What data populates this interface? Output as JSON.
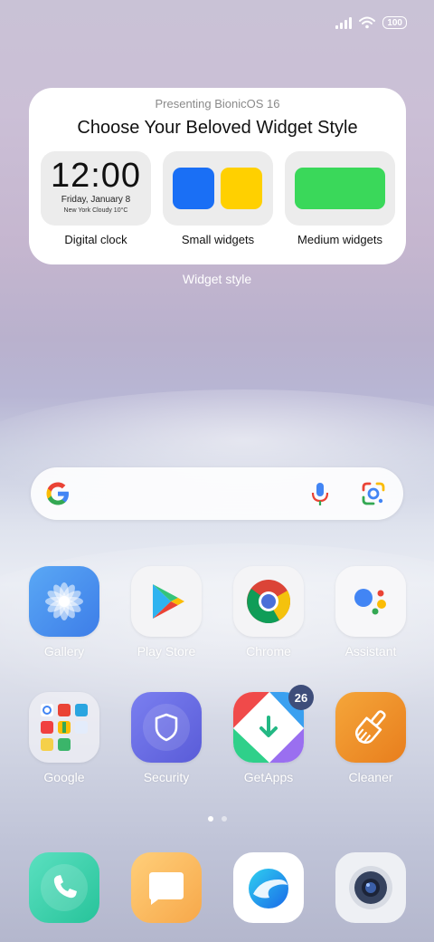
{
  "status_bar": {
    "battery": "100"
  },
  "widget_card": {
    "subtitle": "Presenting BionicOS 16",
    "title": "Choose Your Beloved Widget Style",
    "options": [
      {
        "label": "Digital clock",
        "time": "12:00",
        "date": "Friday, January 8",
        "location": "New York  Cloudy  10°C"
      },
      {
        "label": "Small widgets"
      },
      {
        "label": "Medium widgets"
      }
    ],
    "caption": "Widget style"
  },
  "colors": {
    "small_blue": "#1a6ff5",
    "small_yellow": "#ffd000",
    "medium_green": "#3ad85a"
  },
  "search": {
    "icons": [
      "google-g-icon",
      "microphone-icon",
      "google-lens-icon"
    ]
  },
  "apps": [
    {
      "label": "Gallery"
    },
    {
      "label": "Play Store"
    },
    {
      "label": "Chrome"
    },
    {
      "label": "Assistant"
    },
    {
      "label": "Google"
    },
    {
      "label": "Security"
    },
    {
      "label": "GetApps",
      "badge": "26"
    },
    {
      "label": "Cleaner"
    }
  ],
  "pages": {
    "count": 2,
    "current": 1
  },
  "dock": [
    "phone-icon",
    "messages-icon",
    "browser-icon",
    "camera-icon"
  ]
}
